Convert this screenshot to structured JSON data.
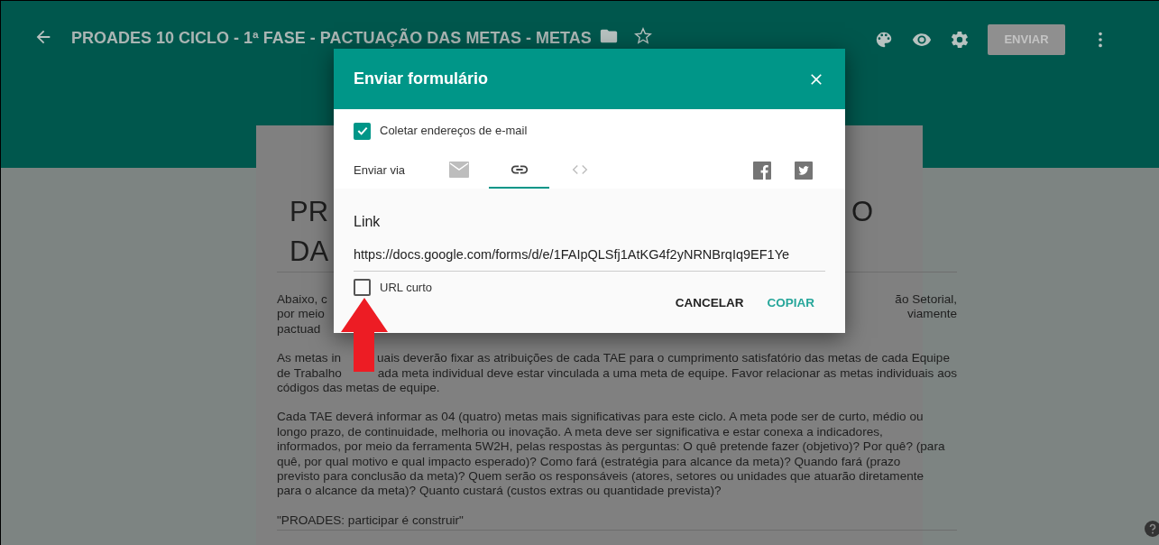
{
  "header": {
    "title": "PROADES 10 CICLO - 1ª FASE - PACTUAÇÃO DAS METAS - METAS",
    "starred": false,
    "send_button": {
      "label": "ENVIAR",
      "disabled": true
    }
  },
  "form": {
    "title_lines": [
      {
        "kind": "split",
        "segments": [
          "PR",
          "O"
        ]
      },
      {
        "segments": [
          "DA"
        ]
      }
    ],
    "paragraphs": [
      {
        "lines": [
          {
            "kind": "split",
            "segments": [
              "Abaixo, c",
              "ão Setorial,"
            ]
          },
          {
            "kind": "split",
            "segments": [
              "por meio",
              "viamente"
            ]
          },
          {
            "segments": [
              "pactuad"
            ]
          }
        ]
      },
      {
        "lines": [
          {
            "kind": "gap",
            "segments": [
              "As metas in",
              "uais deverão fixar as atribuições de cada TAE para o cumprimento satisfatório das metas de cada Equipe"
            ]
          },
          {
            "kind": "gap",
            "segments": [
              "de Trabalho",
              "ada meta individual deve estar vinculada a uma meta de equipe. Favor relacionar as metas individuais aos"
            ]
          },
          {
            "segments": [
              "códigos das metas de equipe."
            ]
          }
        ]
      },
      {
        "lines": [
          {
            "segments": [
              "Cada TAE deverá informar as 04 (quatro) metas mais significativas para este ciclo. A meta pode ser de curto, médio ou"
            ]
          },
          {
            "segments": [
              "longo prazo, de continuidade, melhoria ou inovação. A meta deve ser significativa e estar conexa a indicadores,"
            ]
          },
          {
            "segments": [
              "informados, por meio da ferramenta 5W2H, pelas respostas às perguntas: O quê pretende fazer (objetivo)? Por quê? (para"
            ]
          },
          {
            "segments": [
              "quê, por qual motivo e qual impacto esperado)? Como fará (estratégia para alcance da meta)? Quando fará (prazo"
            ]
          },
          {
            "segments": [
              "previsto para conclusão da meta)? Quem serão os responsáveis (atores, setores ou unidades que atuarão diretamente"
            ]
          },
          {
            "segments": [
              "para o alcance da meta)? Quanto custará (custos extras ou quantidade prevista)?"
            ]
          }
        ]
      },
      {
        "lines": [
          {
            "segments": [
              "\"PROADES: participar é construir\""
            ]
          }
        ]
      }
    ]
  },
  "dialog": {
    "title": "Enviar formulário",
    "collect_emails": {
      "label": "Coletar endereços de e-mail",
      "checked": true
    },
    "send_via": {
      "label": "Enviar via",
      "tabs": [
        {
          "kind": "email",
          "selected": false
        },
        {
          "kind": "link",
          "selected": true
        },
        {
          "kind": "embed",
          "selected": false
        }
      ]
    },
    "link": {
      "heading": "Link",
      "url": "https://docs.google.com/forms/d/e/1FAIpQLSfj1AtKG4f2yNRNBrqIq9EF1Ye"
    },
    "short_url": {
      "label": "URL curto",
      "checked": false
    },
    "buttons": [
      {
        "label": "CANCELAR",
        "kind": "secondary"
      },
      {
        "label": "COPIAR",
        "kind": "primary"
      }
    ]
  },
  "annotation": {
    "kind": "arrow"
  }
}
